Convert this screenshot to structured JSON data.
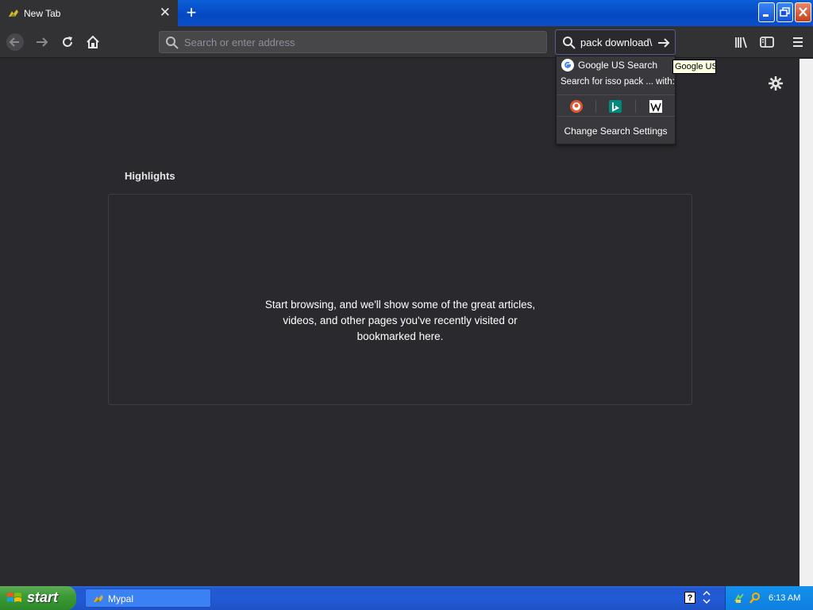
{
  "tab": {
    "label": "New Tab",
    "close_glyph": "✕"
  },
  "newtab_glyph": "+",
  "urlbar": {
    "placeholder": "Search or enter address",
    "value": ""
  },
  "searchbar": {
    "value": "pack download\\"
  },
  "search_popup": {
    "engine_label": "Google US Search",
    "search_for": "Search for isso pack ... with:",
    "engines": [
      "duckduckgo-icon",
      "bing-icon",
      "wikipedia-icon"
    ],
    "change_settings": "Change Search Settings"
  },
  "tooltip": "Google US",
  "highlights": {
    "title": "Highlights",
    "empty_message": "Start browsing, and we'll show some of the great articles, videos, and other pages you've recently visited or bookmarked here."
  },
  "taskbar": {
    "start_label": "start",
    "task_label": "Mypal",
    "help_glyph": "?",
    "clock": "6:13 AM"
  },
  "colors": {
    "content_bg": "#2a2a2e",
    "toolbar_bg": "#323234",
    "xp_blue": "#225ad6",
    "start_green": "#3c9a36"
  }
}
